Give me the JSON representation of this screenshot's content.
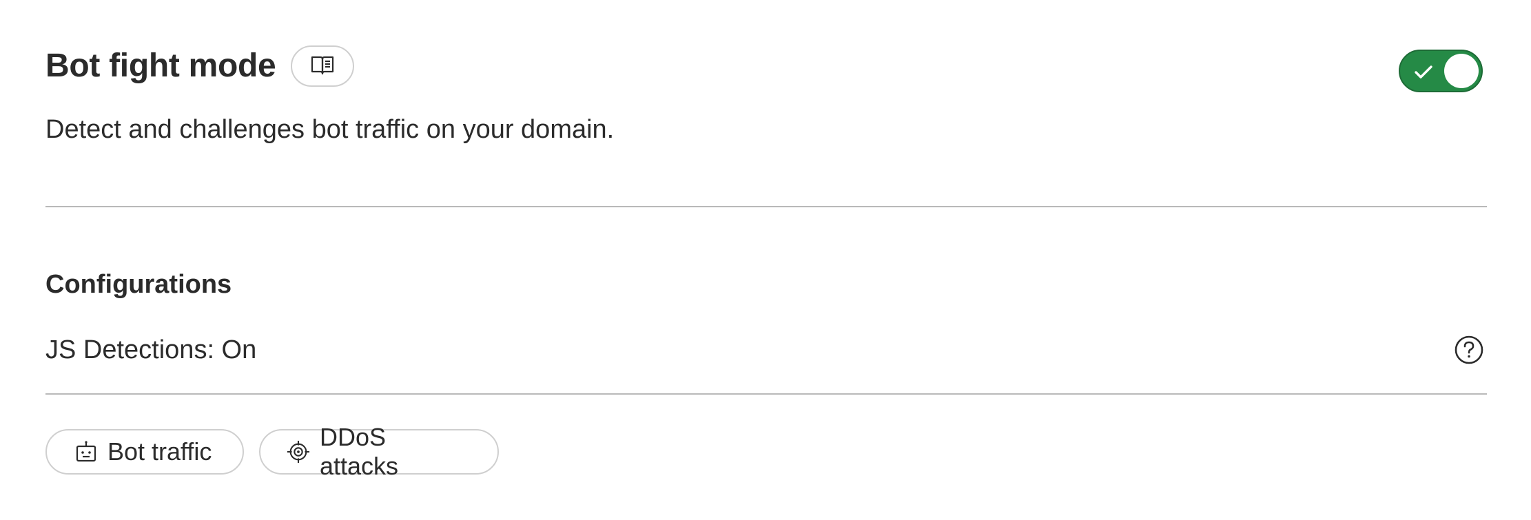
{
  "header": {
    "title": "Bot fight mode",
    "doc_icon": "book-open-icon"
  },
  "description": "Detect and challenges bot traffic on your domain.",
  "toggle": {
    "state": "on",
    "icon": "check-icon",
    "color": "#258a46"
  },
  "configurations": {
    "title": "Configurations",
    "setting_label": "JS Detections: On",
    "help_icon": "question-circle-icon"
  },
  "tags": [
    {
      "label": "Bot traffic",
      "icon": "robot-icon"
    },
    {
      "label": "DDoS attacks",
      "icon": "crosshair-target-icon"
    }
  ]
}
